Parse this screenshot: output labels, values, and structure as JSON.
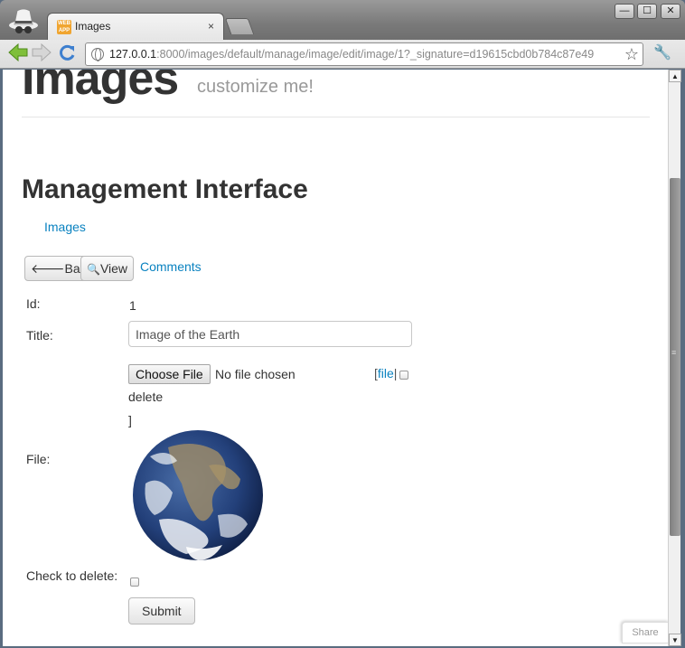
{
  "browser": {
    "tab_title": "Images",
    "tab_favicon_text": "WEB APP",
    "tab_close": "×",
    "window_minimize": "—",
    "window_maximize": "☐",
    "window_close": "✕",
    "url_host": "127.0.0.1",
    "url_rest": ":8000/images/default/manage/image/edit/image/1?_signature=d19615cbd0b784c87e49",
    "back_icon": "arrow-left-icon",
    "forward_icon": "arrow-right-icon",
    "reload_icon": "reload-icon",
    "bookmark_icon": "star-icon",
    "menu_icon": "wrench-icon"
  },
  "header": {
    "brand": "Images",
    "tagline": "customize me!"
  },
  "main": {
    "title": "Management Interface",
    "breadcrumb": "Images",
    "actions": {
      "back_label": "Back",
      "view_label": "View",
      "comments_label": "Comments"
    },
    "form": {
      "id_label": "Id:",
      "id_value": "1",
      "title_label": "Title:",
      "title_value": "Image of the Earth",
      "file_label": "File:",
      "choose_file_label": "Choose File",
      "no_file_text": "No file chosen",
      "file_bracket_open": "[",
      "file_link": "file",
      "file_bracket_close": "|",
      "delete_text": "delete",
      "close_bracket": "]",
      "check_delete_label": "Check to delete:",
      "submit_label": "Submit"
    }
  },
  "share": {
    "label": "Share"
  },
  "colors": {
    "link": "#0a82c0",
    "heading": "#333333",
    "tagline": "#999999"
  }
}
